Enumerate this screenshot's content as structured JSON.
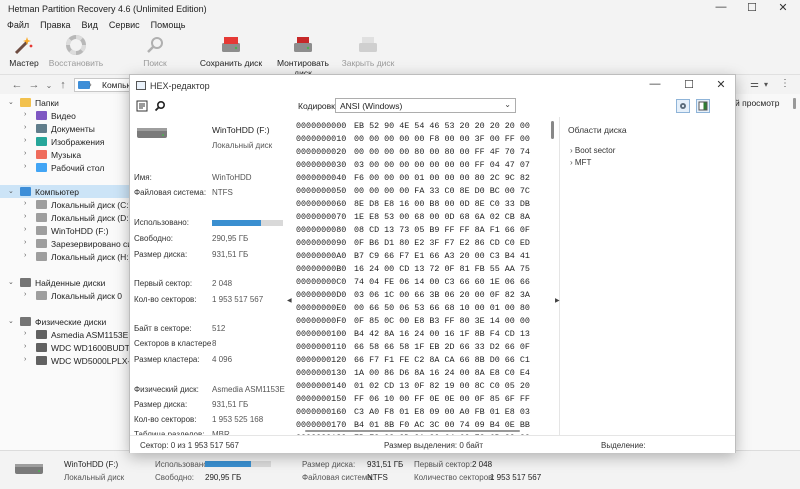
{
  "window": {
    "title": "Hetman Partition Recovery 4.6 (Unlimited Edition)",
    "minimize": "—",
    "maximize": "☐",
    "close": "✕"
  },
  "menu": [
    "Файл",
    "Правка",
    "Вид",
    "Сервис",
    "Помощь"
  ],
  "toolbar": {
    "wizard": "Мастер",
    "restore": "Восстановить",
    "search": "Поиск",
    "save_disk": "Сохранить диск",
    "mount_disk": "Монтировать диск",
    "close_disk": "Закрыть диск"
  },
  "address": {
    "text": "Компьютер"
  },
  "right_panel": {
    "preview": "й просмотр"
  },
  "tree": [
    {
      "label": "Папки",
      "level": 0,
      "expanded": true,
      "icon": "folder-icon",
      "color": "#f2c14e"
    },
    {
      "label": "Видео",
      "level": 1,
      "icon": "video-folder-icon",
      "color": "#7e57c2"
    },
    {
      "label": "Документы",
      "level": 1,
      "icon": "documents-folder-icon",
      "color": "#607d8b"
    },
    {
      "label": "Изображения",
      "level": 1,
      "icon": "pictures-folder-icon",
      "color": "#26a69a"
    },
    {
      "label": "Музыка",
      "level": 1,
      "icon": "music-folder-icon",
      "color": "#ef6c5c"
    },
    {
      "label": "Рабочий стол",
      "level": 1,
      "icon": "desktop-folder-icon",
      "color": "#42a5f5"
    },
    {
      "label": "Компьютер",
      "level": 0,
      "expanded": true,
      "selected": true,
      "icon": "computer-icon",
      "color": "#3d8ed8"
    },
    {
      "label": "Локальный диск (C:)",
      "level": 1,
      "icon": "drive-icon",
      "color": "#9e9e9e"
    },
    {
      "label": "Локальный диск (D:)",
      "level": 1,
      "icon": "drive-icon",
      "color": "#9e9e9e"
    },
    {
      "label": "WinToHDD (F:)",
      "level": 1,
      "icon": "drive-icon",
      "color": "#9e9e9e"
    },
    {
      "label": "Зарезервировано систем",
      "level": 1,
      "icon": "drive-icon",
      "color": "#9e9e9e"
    },
    {
      "label": "Локальный диск (H:)",
      "level": 1,
      "icon": "drive-icon",
      "color": "#9e9e9e"
    },
    {
      "label": "Найденные диски",
      "level": 0,
      "expanded": true,
      "icon": "found-drives-icon",
      "color": "#757575"
    },
    {
      "label": "Локальный диск 0",
      "level": 1,
      "icon": "drive-icon",
      "color": "#9e9e9e"
    },
    {
      "label": "Физические диски",
      "level": 0,
      "expanded": true,
      "icon": "physical-drives-icon",
      "color": "#757575"
    },
    {
      "label": "Asmedia ASM1153E SCSI",
      "level": 1,
      "icon": "hdd-icon",
      "color": "#616161"
    },
    {
      "label": "WDC WD1600BUDT-63D",
      "level": 1,
      "icon": "hdd-icon",
      "color": "#616161"
    },
    {
      "label": "WDC WD5000LPLX-00ZN",
      "level": 1,
      "icon": "hdd-icon",
      "color": "#616161"
    }
  ],
  "hex_window": {
    "title": "HEX-редактор",
    "encoding_label": "Кодировка",
    "encoding_value": "ANSI (Windows)",
    "minimize": "—",
    "maximize": "☐",
    "close": "✕"
  },
  "disk_info": {
    "name": "WinToHDD (F:)",
    "type": "Локальный диск",
    "rows": [
      {
        "k": "Имя:",
        "v": "WinToHDD"
      },
      {
        "k": "Файловая система:",
        "v": "NTFS"
      },
      {
        "k": "Использовано:",
        "v": ""
      },
      {
        "k": "Свободно:",
        "v": "290,95 ГБ"
      },
      {
        "k": "Размер диска:",
        "v": "931,51 ГБ"
      },
      {
        "k": "Первый сектор:",
        "v": "2 048"
      },
      {
        "k": "Кол-во секторов:",
        "v": "1 953 517 567"
      },
      {
        "k": "Байт в секторе:",
        "v": "512"
      },
      {
        "k": "Секторов в кластере",
        "v": "8"
      },
      {
        "k": "Размер кластера:",
        "v": "4 096"
      },
      {
        "k": "Физический диск:",
        "v": "Asmedia ASM1153E SC"
      },
      {
        "k": "Размер диска:",
        "v": "931,51 ГБ"
      },
      {
        "k": "Кол-во секторов:",
        "v": "1 953 525 168"
      },
      {
        "k": "Таблица разделов:",
        "v": "MBR"
      }
    ],
    "used_fraction": 0.69
  },
  "hex_rows": [
    {
      "off": "0000000000",
      "bytes": "EB 52 90 4E 54 46 53 20 20 20 20 00"
    },
    {
      "off": "0000000010",
      "bytes": "00 00 00 00 00 F8 00 00 3F 00 FF 00"
    },
    {
      "off": "0000000020",
      "bytes": "00 00 00 00 80 00 80 00 FF 4F 70 74"
    },
    {
      "off": "0000000030",
      "bytes": "03 00 00 00 00 00 00 00 FF 04 47 07"
    },
    {
      "off": "0000000040",
      "bytes": "F6 00 00 00 01 00 00 00 80 2C 9C 82"
    },
    {
      "off": "0000000050",
      "bytes": "00 00 00 00 FA 33 C0 8E D0 BC 00 7C"
    },
    {
      "off": "0000000060",
      "bytes": "8E D8 E8 16 00 B8 00 0D 8E C0 33 DB"
    },
    {
      "off": "0000000070",
      "bytes": "1E E8 53 00 68 00 0D 68 6A 02 CB 8A"
    },
    {
      "off": "0000000080",
      "bytes": "08 CD 13 73 05 B9 FF FF 8A F1 66 0F"
    },
    {
      "off": "0000000090",
      "bytes": "0F B6 D1 80 E2 3F F7 E2 86 CD C0 ED"
    },
    {
      "off": "00000000A0",
      "bytes": "B7 C9 66 F7 E1 66 A3 20 00 C3 B4 41"
    },
    {
      "off": "00000000B0",
      "bytes": "16 24 00 CD 13 72 0F 81 FB 55 AA 75"
    },
    {
      "off": "00000000C0",
      "bytes": "74 04 FE 06 14 00 C3 66 60 1E 06 66"
    },
    {
      "off": "00000000D0",
      "bytes": "03 06 1C 00 66 3B 06 20 00 0F 82 3A"
    },
    {
      "off": "00000000E0",
      "bytes": "00 66 50 06 53 66 68 10 00 01 00 80"
    },
    {
      "off": "00000000F0",
      "bytes": "0F 85 0C 00 E8 B3 FF 80 3E 14 00 00"
    },
    {
      "off": "0000000100",
      "bytes": "B4 42 8A 16 24 00 16 1F 8B F4 CD 13"
    },
    {
      "off": "0000000110",
      "bytes": "66 58 66 58 1F EB 2D 66 33 D2 66 0F"
    },
    {
      "off": "0000000120",
      "bytes": "66 F7 F1 FE C2 8A CA 66 8B D0 66 C1"
    },
    {
      "off": "0000000130",
      "bytes": "1A 00 86 D6 8A 16 24 00 8A E8 C0 E4"
    },
    {
      "off": "0000000140",
      "bytes": "01 02 CD 13 0F 82 19 00 8C C0 05 20"
    },
    {
      "off": "0000000150",
      "bytes": "FF 06 10 00 FF 0E 0E 00 0F 85 6F FF"
    },
    {
      "off": "0000000160",
      "bytes": "C3 A0 F8 01 E8 09 00 A0 FB 01 E8 03"
    },
    {
      "off": "0000000170",
      "bytes": "B4 01 8B F0 AC 3C 00 74 09 B4 0E BB"
    },
    {
      "off": "0000000180",
      "bytes": "EB F2 C3 0D 0A 20 64 69 73 6B 20 20"
    }
  ],
  "disk_areas": {
    "title": "Области диска",
    "items": [
      "Boot sector",
      "MFT"
    ]
  },
  "hex_status": {
    "sector": "Сектор: 0 из 1 953 517 567",
    "selection_size": "Размер выделения: 0 байт",
    "selection": "Выделение:"
  },
  "bottom_status": {
    "name": "WinToHDD (F:)",
    "type": "Локальный диск",
    "used_label": "Использовано:",
    "free_label": "Свободно:",
    "free_value": "290,95 ГБ",
    "size_label": "Размер диска:",
    "size_value": "931,51 ГБ",
    "fs_label": "Файловая система:",
    "fs_value": "NTFS",
    "first_sector_label": "Первый сектор:",
    "first_sector_value": "2 048",
    "sector_count_label": "Количество секторов:",
    "sector_count_value": "1 953 517 567",
    "used_fraction": 0.69
  },
  "colors": {
    "accent": "#3a8fd0",
    "selection": "#cce4f7"
  }
}
